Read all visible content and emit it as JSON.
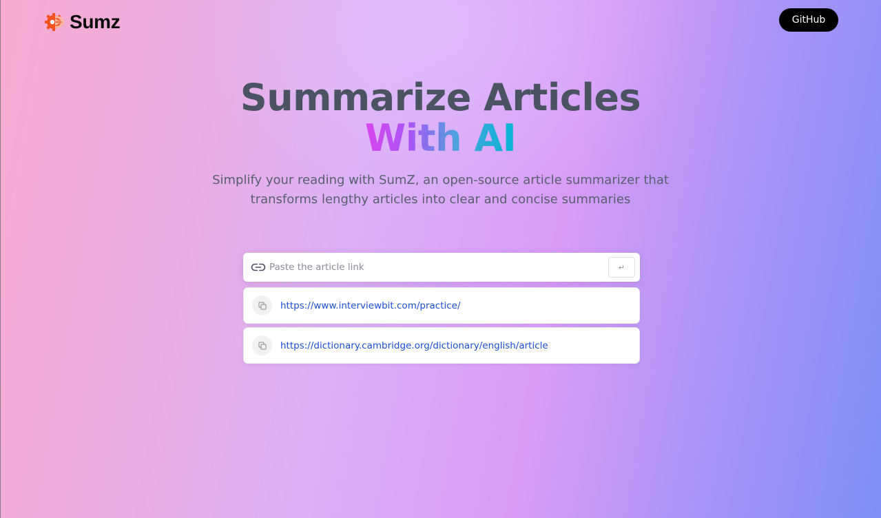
{
  "header": {
    "logo_text": "Sumz",
    "github_label": "GitHub"
  },
  "hero": {
    "title": "Summarize Articles",
    "accent": "With AI",
    "subtitle_line1": "Simplify your reading with SumZ, an open-source article summarizer that",
    "subtitle_line2": "transforms lengthy articles into clear and concise summaries"
  },
  "form": {
    "placeholder": "Paste the article link",
    "value": "",
    "submit_symbol": "↵"
  },
  "history": [
    {
      "url": "https://www.interviewbit.com/practice/"
    },
    {
      "url": "https://dictionary.cambridge.org/dictionary/english/article"
    }
  ],
  "icons": {
    "logo": "brain-gear-icon",
    "link": "link-icon",
    "copy": "copy-icon",
    "submit": "enter-icon"
  },
  "colors": {
    "title": "#4b5363",
    "accent_start": "#d946ef",
    "accent_end": "#06b6d4",
    "link": "#1d4ed8",
    "logo_orange": "#f4511e"
  }
}
